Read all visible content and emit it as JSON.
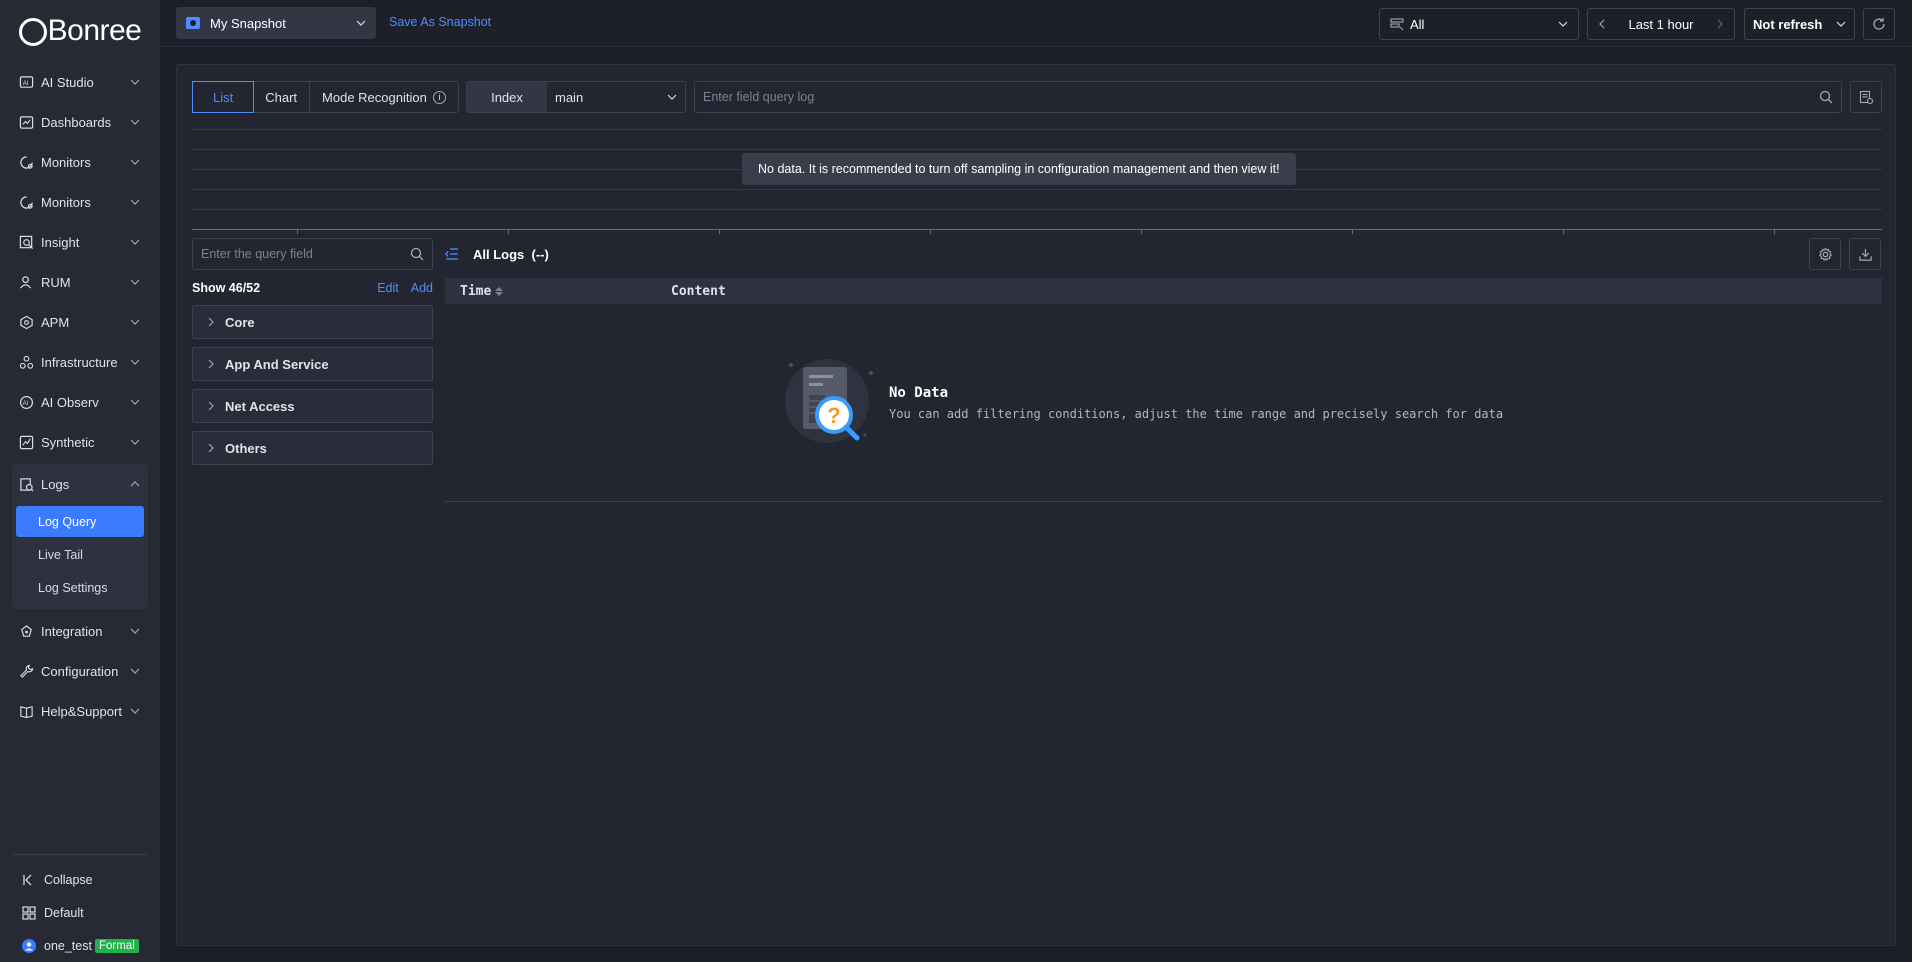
{
  "brand": {
    "name": "Bonree"
  },
  "sidebar": {
    "items": [
      {
        "label": "AI Studio",
        "icon": "ai-studio-icon"
      },
      {
        "label": "Dashboards",
        "icon": "dashboard-icon"
      },
      {
        "label": "Monitors",
        "icon": "monitor-icon"
      },
      {
        "label": "Monitors",
        "icon": "monitor-icon"
      },
      {
        "label": "Insight",
        "icon": "insight-icon"
      },
      {
        "label": "RUM",
        "icon": "rum-icon"
      },
      {
        "label": "APM",
        "icon": "apm-icon"
      },
      {
        "label": "Infrastructure",
        "icon": "infrastructure-icon"
      },
      {
        "label": "AI Observ",
        "icon": "ai-observ-icon"
      },
      {
        "label": "Synthetic",
        "icon": "synthetic-icon"
      }
    ],
    "logs": {
      "label": "Logs",
      "subitems": [
        {
          "label": "Log Query",
          "active": true
        },
        {
          "label": "Live Tail",
          "active": false
        },
        {
          "label": "Log Settings",
          "active": false
        }
      ]
    },
    "items_after": [
      {
        "label": "Integration",
        "icon": "integration-icon"
      },
      {
        "label": "Configuration",
        "icon": "configuration-icon"
      },
      {
        "label": "Help&Support",
        "icon": "help-icon"
      }
    ],
    "bottom": {
      "collapse": "Collapse",
      "default": "Default",
      "user": "one_test",
      "badge": "Formal"
    }
  },
  "topbar": {
    "snapshot": "My Snapshot",
    "save_snapshot": "Save As Snapshot",
    "app_filter": "All",
    "time_range": "Last 1 hour",
    "refresh": "Not refresh"
  },
  "query": {
    "tabs": [
      {
        "label": "List",
        "active": true
      },
      {
        "label": "Chart",
        "active": false
      },
      {
        "label": "Mode Recognition",
        "active": false
      }
    ],
    "index_label": "Index",
    "index_value": "main",
    "placeholder": "Enter field query log"
  },
  "chart": {
    "no_data_tip": "No data. It is recommended to turn off sampling in configuration management and then view it!"
  },
  "fields": {
    "search_placeholder": "Enter the query field",
    "count_label": "Show 46/52",
    "edit": "Edit",
    "add": "Add",
    "groups": [
      "Core",
      "App And Service",
      "Net Access",
      "Others"
    ]
  },
  "logs": {
    "title": "All Logs",
    "count": "(--)",
    "columns": [
      "Time",
      "Content"
    ],
    "empty_title": "No Data",
    "empty_desc": "You can add filtering conditions, adjust the time range and precisely search for data"
  },
  "colors": {
    "accent": "#3a7bff",
    "link": "#4f8cff",
    "badge": "#1fb24a",
    "background": "#1c1e27",
    "sidebar": "#272a35"
  }
}
